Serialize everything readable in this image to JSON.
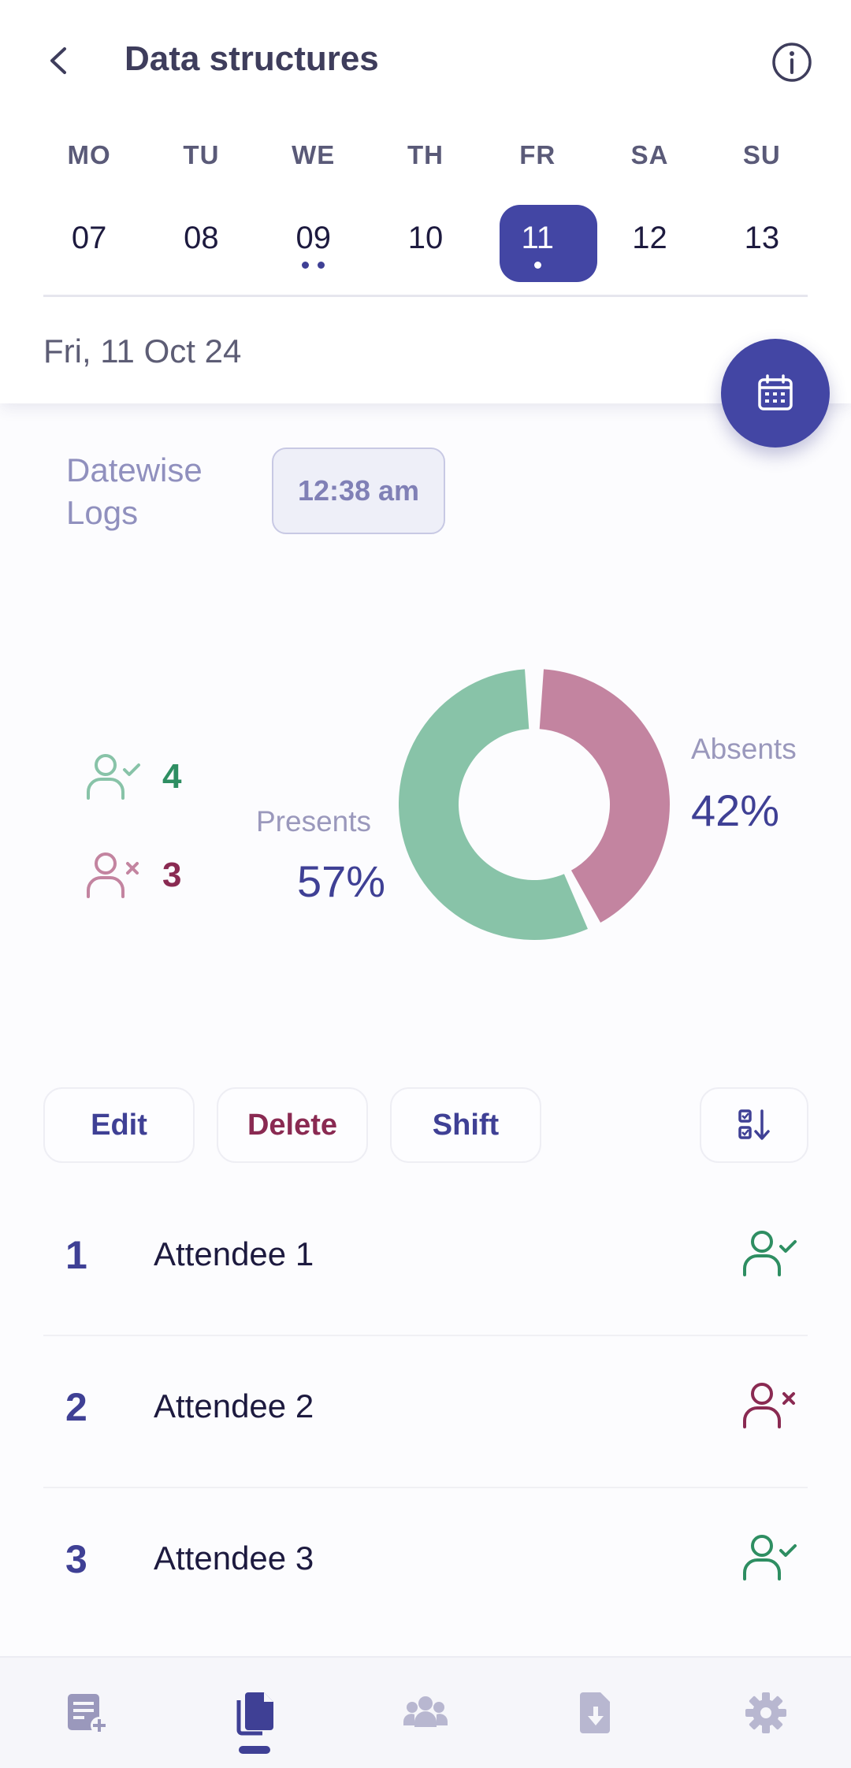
{
  "header": {
    "title": "Data structures"
  },
  "week": {
    "days": [
      "MO",
      "TU",
      "WE",
      "TH",
      "FR",
      "SA",
      "SU"
    ],
    "dates": [
      {
        "num": "07",
        "dots": 0,
        "selected": false
      },
      {
        "num": "08",
        "dots": 0,
        "selected": false
      },
      {
        "num": "09",
        "dots": 2,
        "selected": false
      },
      {
        "num": "10",
        "dots": 0,
        "selected": false
      },
      {
        "num": "11",
        "dots": 1,
        "selected": true
      },
      {
        "num": "12",
        "dots": 0,
        "selected": false
      },
      {
        "num": "13",
        "dots": 0,
        "selected": false
      }
    ]
  },
  "full_date": "Fri, 11 Oct 24",
  "logs": {
    "label_line1": "Datewise",
    "label_line2": "Logs",
    "time": "12:38 am"
  },
  "stats": {
    "present_count": "4",
    "absent_count": "3"
  },
  "chart_data": {
    "type": "pie",
    "categories": [
      "Presents",
      "Absents"
    ],
    "values": [
      57,
      42
    ],
    "labels": [
      "57%",
      "42%"
    ],
    "colors": [
      "#88c3a8",
      "#c384a0"
    ]
  },
  "actions": {
    "edit": "Edit",
    "delete": "Delete",
    "shift": "Shift"
  },
  "attendees": [
    {
      "idx": "1",
      "name": "Attendee 1",
      "status": "present"
    },
    {
      "idx": "2",
      "name": "Attendee 2",
      "status": "absent"
    },
    {
      "idx": "3",
      "name": "Attendee 3",
      "status": "present"
    }
  ],
  "nav": {
    "items": [
      "add-note-icon",
      "documents-icon",
      "group-icon",
      "download-file-icon",
      "settings-icon"
    ],
    "active": "documents-icon"
  },
  "colors": {
    "accent": "#4346a4",
    "present": "#2e8e62",
    "absent": "#8a2a52",
    "muted": "#9a98bc"
  }
}
